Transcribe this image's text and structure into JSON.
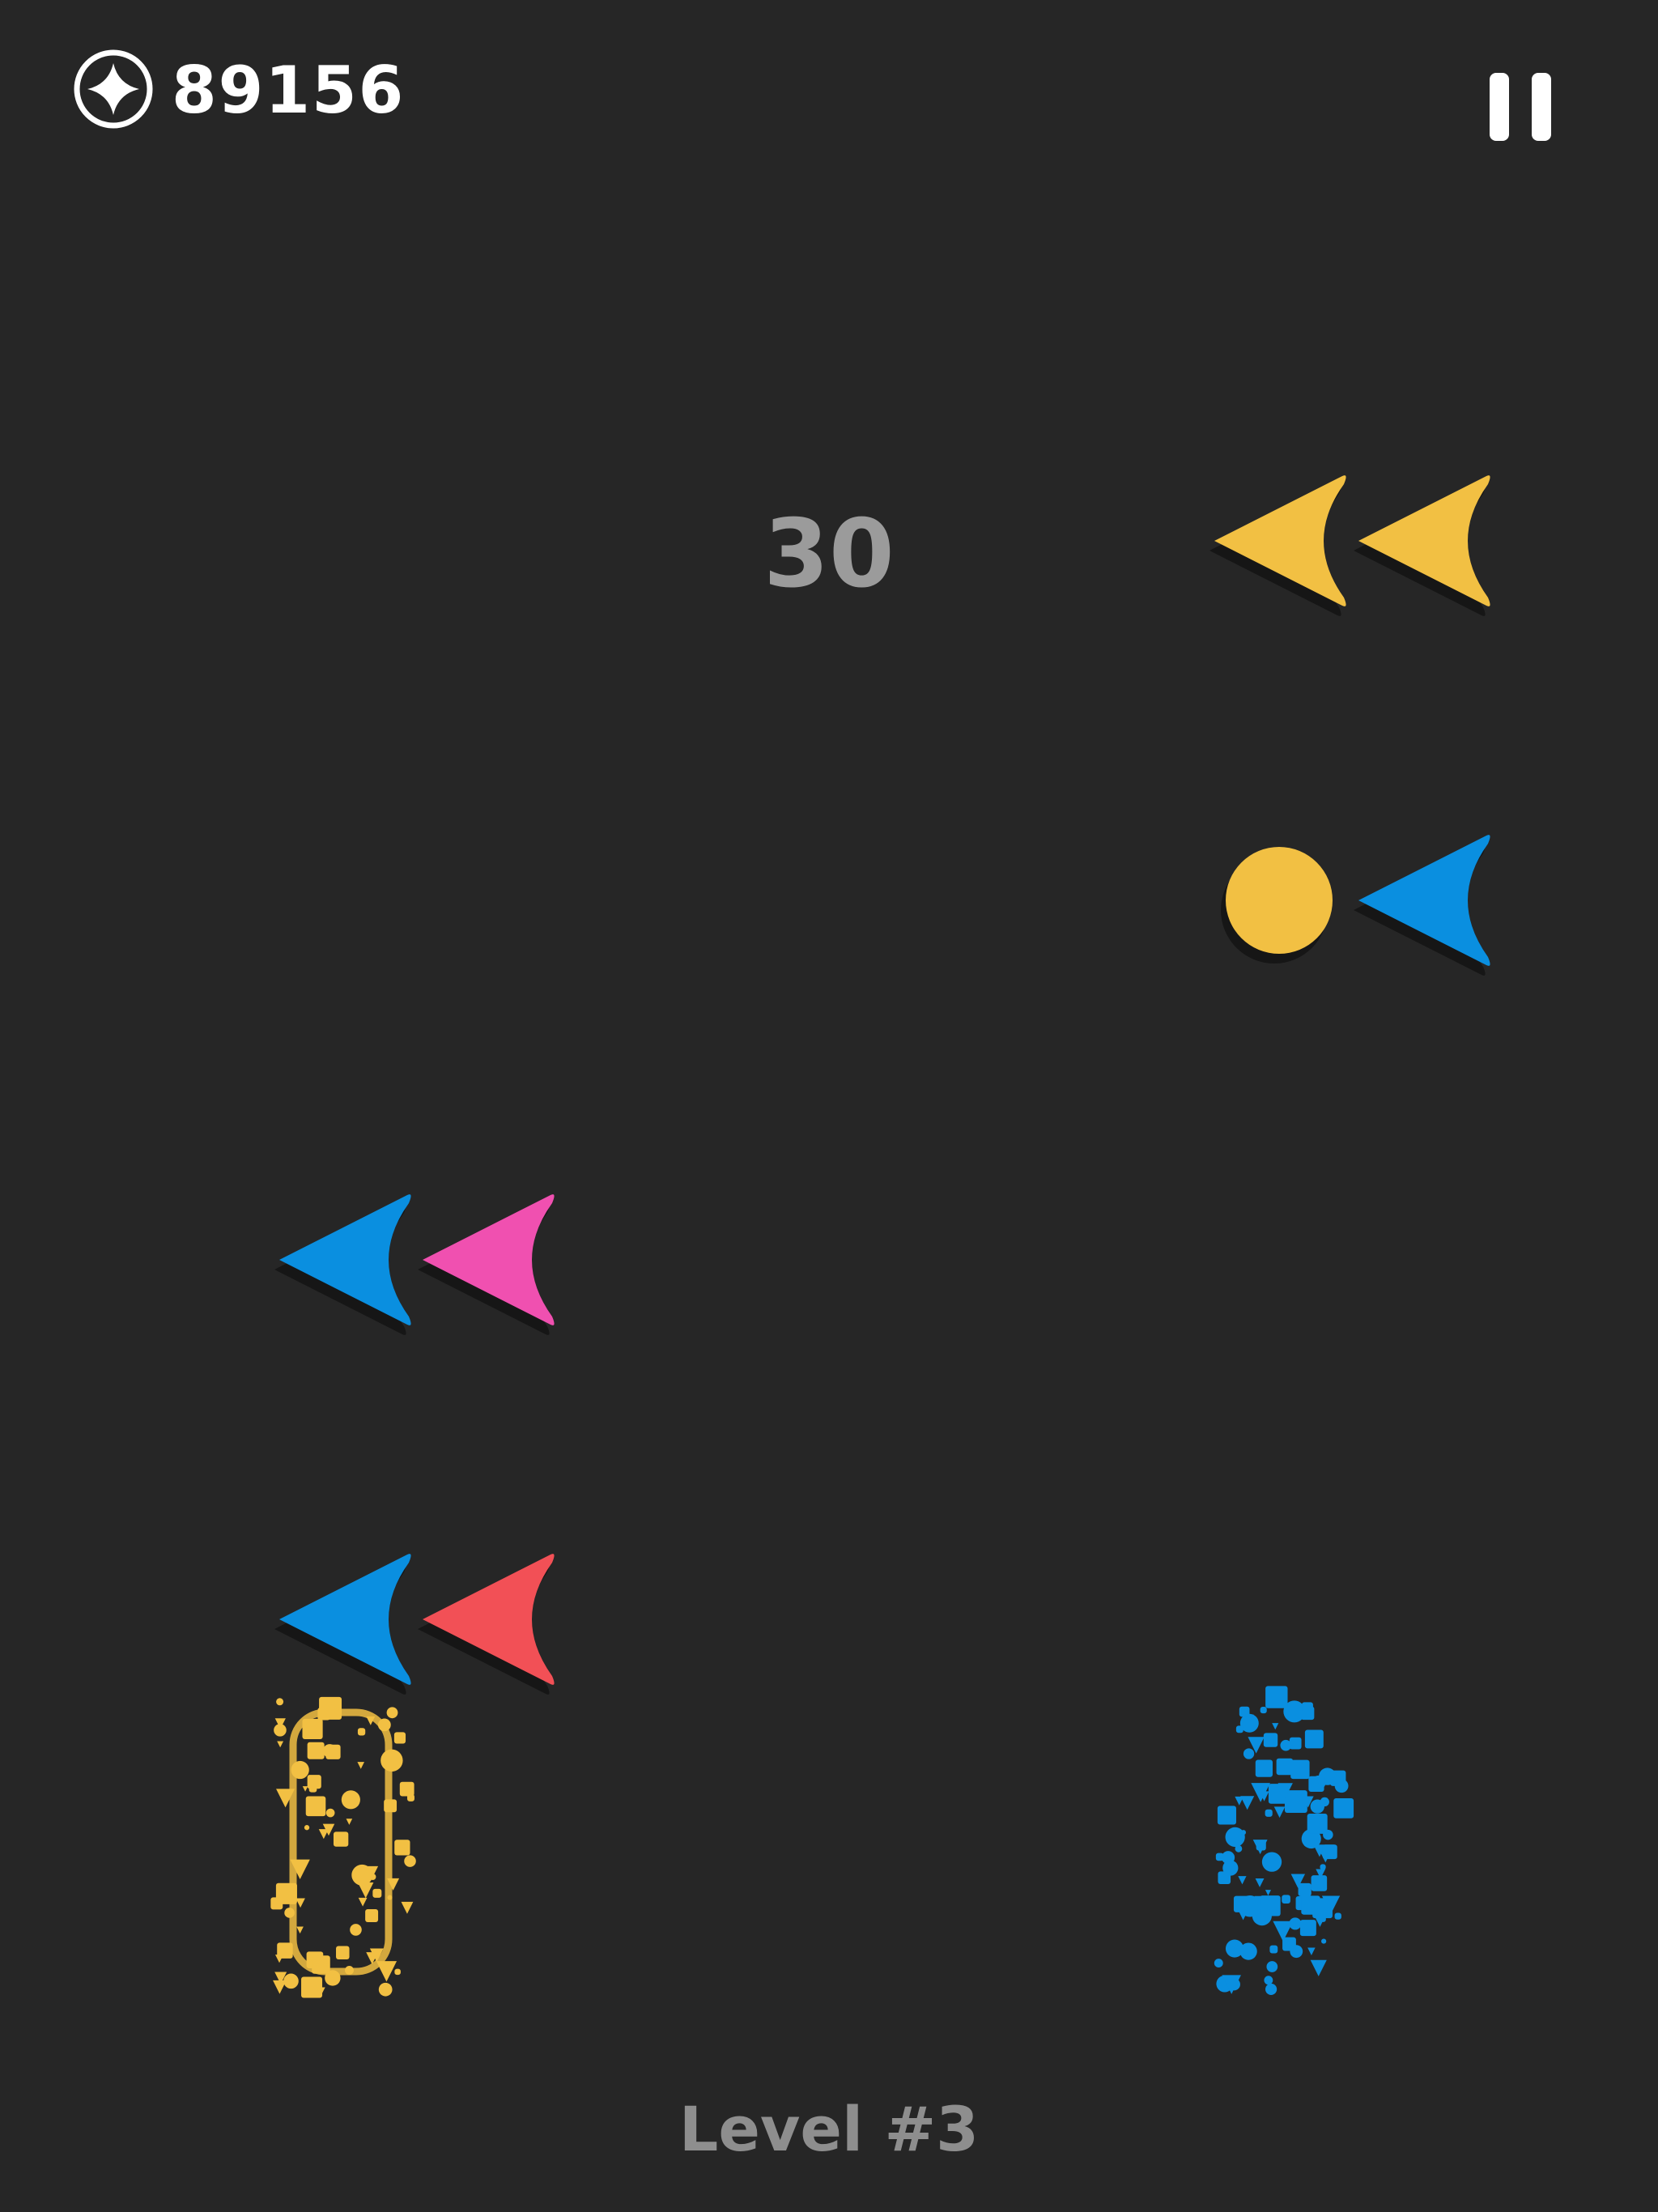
{
  "hud": {
    "coin_icon": "star-coin-icon",
    "coin_count": "89156",
    "pause_icon": "pause-icon"
  },
  "counter": "30",
  "level_label": "Level #3",
  "colors": {
    "background": "#262626",
    "yellow": "#F2C043",
    "blue": "#0A8FE0",
    "pink": "#F050B0",
    "red": "#F25056",
    "shadow": "#161616"
  },
  "pieces": [
    {
      "name": "yellow-arrow",
      "color": "yellow",
      "shape": "arrow"
    },
    {
      "name": "yellow-arrow",
      "color": "yellow",
      "shape": "arrow"
    },
    {
      "name": "yellow-ball",
      "color": "yellow",
      "shape": "ball"
    },
    {
      "name": "blue-arrow",
      "color": "blue",
      "shape": "arrow"
    },
    {
      "name": "blue-arrow",
      "color": "blue",
      "shape": "arrow"
    },
    {
      "name": "pink-arrow",
      "color": "pink",
      "shape": "arrow"
    },
    {
      "name": "blue-arrow",
      "color": "blue",
      "shape": "arrow"
    },
    {
      "name": "red-arrow",
      "color": "red",
      "shape": "arrow"
    }
  ],
  "shatter": [
    {
      "name": "yellow-shatter",
      "color": "yellow"
    },
    {
      "name": "blue-shatter",
      "color": "blue"
    }
  ]
}
